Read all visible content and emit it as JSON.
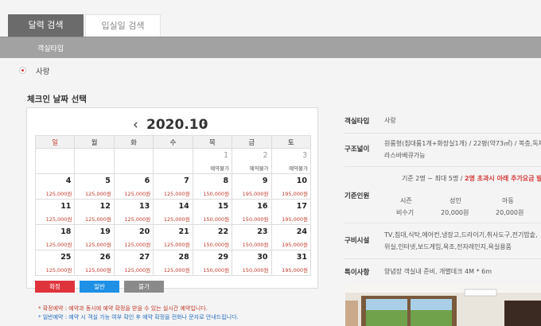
{
  "tabs": [
    {
      "label": "달력 검색"
    },
    {
      "label": "입실일 검색"
    }
  ],
  "section_bar": {
    "label": "객실타입"
  },
  "room_option": {
    "label": "사랑",
    "selected": true
  },
  "checkin_title": "체크인 날짜 선택",
  "calendar": {
    "prev_icon": "‹",
    "next_icon": "›",
    "month_label": "2020.10",
    "weekdays": [
      "일",
      "월",
      "화",
      "수",
      "목",
      "금",
      "토"
    ],
    "weeks": [
      [
        {
          "day": "",
          "price": ""
        },
        {
          "day": "",
          "price": ""
        },
        {
          "day": "",
          "price": ""
        },
        {
          "day": "",
          "price": ""
        },
        {
          "day": "1",
          "price": "예약불가"
        },
        {
          "day": "2",
          "price": "예약불가"
        },
        {
          "day": "3",
          "price": "예약불가"
        }
      ],
      [
        {
          "day": "4",
          "price": "125,000원"
        },
        {
          "day": "5",
          "price": "125,000원"
        },
        {
          "day": "6",
          "price": "125,000원"
        },
        {
          "day": "7",
          "price": "125,000원"
        },
        {
          "day": "8",
          "price": "150,000원"
        },
        {
          "day": "9",
          "price": "195,000원"
        },
        {
          "day": "10",
          "price": "195,000원"
        }
      ],
      [
        {
          "day": "11",
          "price": "125,000원"
        },
        {
          "day": "12",
          "price": "125,000원"
        },
        {
          "day": "13",
          "price": "125,000원"
        },
        {
          "day": "14",
          "price": "125,000원"
        },
        {
          "day": "15",
          "price": "150,000원"
        },
        {
          "day": "16",
          "price": "150,000원"
        },
        {
          "day": "17",
          "price": "195,000원"
        }
      ],
      [
        {
          "day": "18",
          "price": "125,000원"
        },
        {
          "day": "19",
          "price": "125,000원"
        },
        {
          "day": "20",
          "price": "125,000원"
        },
        {
          "day": "21",
          "price": "125,000원"
        },
        {
          "day": "22",
          "price": "150,000원"
        },
        {
          "day": "23",
          "price": "150,000원"
        },
        {
          "day": "24",
          "price": "195,000원"
        }
      ],
      [
        {
          "day": "25",
          "price": "125,000원"
        },
        {
          "day": "26",
          "price": "125,000원"
        },
        {
          "day": "27",
          "price": "125,000원"
        },
        {
          "day": "28",
          "price": "125,000원"
        },
        {
          "day": "29",
          "price": "150,000원"
        },
        {
          "day": "30",
          "price": "150,000원"
        },
        {
          "day": "31",
          "price": "195,000원"
        }
      ]
    ],
    "legend": [
      {
        "label": "확정",
        "color": "#e0343c"
      },
      {
        "label": "일반",
        "color": "#1e90e6"
      },
      {
        "label": "불가",
        "color": "#8a8a8a"
      }
    ]
  },
  "notes": [
    "* 확정예약 : 예약과 동시에 예약 확정을 받을 수 있는 실시간 예약입니다.",
    "* 일반예약 : 예약 시 객실 가능 여부 확인 후 예약 확정을 전화나 문자로 안내드립니다."
  ],
  "info": {
    "room_type_label": "객실타입",
    "room_type_value": "사랑",
    "structure_label": "구조넓이",
    "structure_line1": "원룸형(침대룸1개+화장실1개) / 22평(약73㎡) / 복층,독채",
    "structure_line2": "라스바베큐가능",
    "capacity_label": "기준인원",
    "capacity_text": "기준 2명 ~ 최대 5명 / ",
    "capacity_warning": "2명 초과시 아래 추가요금 발",
    "season_headers": [
      "시즌",
      "성인",
      "아동"
    ],
    "season_row": [
      "비수기",
      "20,000원",
      "20,000원"
    ],
    "amenities_label": "구비시설",
    "amenities_line1": "TV,침대,식탁,에어컨,냉장고,드라이기,취사도구,전기밥솥,",
    "amenities_line2": "위실,인터넷,보드게임,욕조,전자레인지,욕실용품",
    "notes_label": "특이사항",
    "notes_value": "양념장 객실내 준비, 개별데크 4M * 6m"
  }
}
